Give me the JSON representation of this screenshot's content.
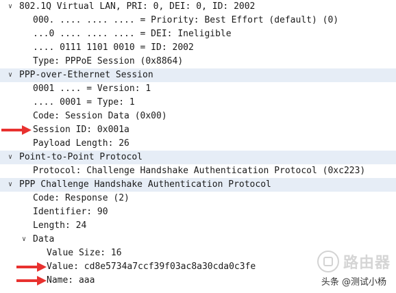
{
  "tree": {
    "vlan": {
      "header": "802.1Q Virtual LAN, PRI: 0, DEI: 0, ID: 2002",
      "priority": "000. .... .... .... = Priority: Best Effort (default) (0)",
      "dei": "...0 .... .... .... = DEI: Ineligible",
      "id": ".... 0111 1101 0010 = ID: 2002",
      "type": "Type: PPPoE Session (0x8864)"
    },
    "pppoe": {
      "header": "PPP-over-Ethernet Session",
      "version": "0001 .... = Version: 1",
      "type": ".... 0001 = Type: 1",
      "code": "Code: Session Data (0x00)",
      "session_id": "Session ID: 0x001a",
      "payload_length": "Payload Length: 26"
    },
    "ppp": {
      "header": "Point-to-Point Protocol",
      "protocol": "Protocol: Challenge Handshake Authentication Protocol (0xc223)"
    },
    "chap": {
      "header": "PPP Challenge Handshake Authentication Protocol",
      "code": "Code: Response (2)",
      "identifier": "Identifier: 90",
      "length": "Length: 24",
      "data": {
        "header": "Data",
        "value_size": "Value Size: 16",
        "value": "Value: cd8e5734a7ccf39f03ac8a30cda0c3fe",
        "name": "Name: aaa"
      }
    }
  },
  "watermark": {
    "brand": "路由器",
    "author": "头条 @测试小杨"
  },
  "colors": {
    "selected_row": "#e6edf6",
    "arrow": "#e8312f"
  },
  "icons": [
    "chevron-down-icon",
    "red-arrow-icon",
    "watermark-logo-icon"
  ]
}
